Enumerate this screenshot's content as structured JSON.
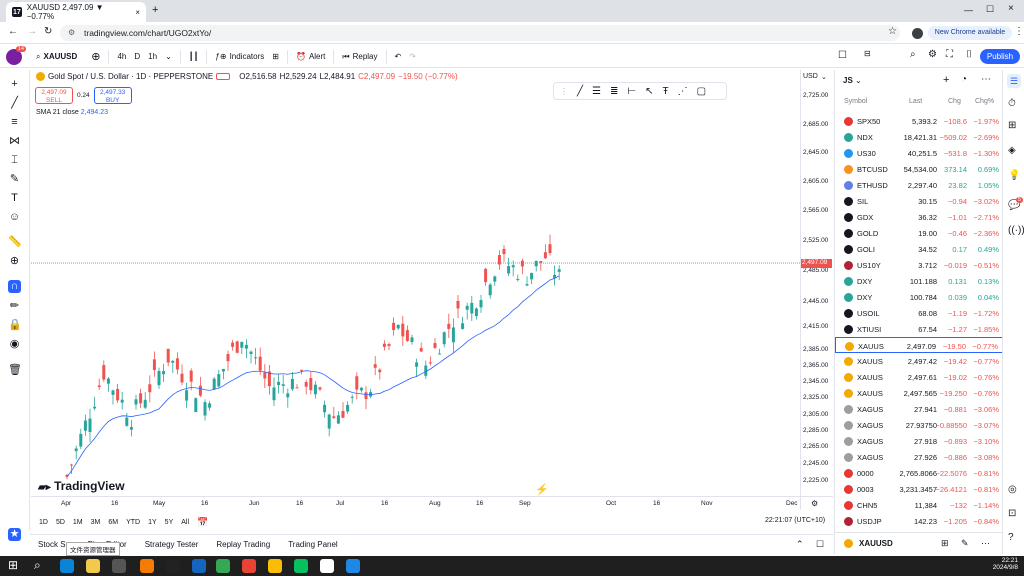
{
  "browser": {
    "tab_title": "XAUUSD 2,497.09 ▼ −0.77%",
    "url": "tradingview.com/chart/UGO2xtYo/",
    "update_btn": "New Chrome available"
  },
  "toolbar": {
    "symbol": "XAUUSD",
    "intervals": [
      "4h",
      "D",
      "1h"
    ],
    "indicators": "Indicators",
    "alert": "Alert",
    "replay": "Replay",
    "publish": "Publish",
    "badge": "14"
  },
  "legend": {
    "title": "Gold Spot / U.S. Dollar · 1D · PEPPERSTONE",
    "o": "O2,516.58",
    "h": "H2,529.24",
    "l": "L2,484.91",
    "c": "C2,497.09",
    "chg": "−19.50 (−0.77%)",
    "sell": "2,497.09",
    "sell_label": "SELL",
    "spread": "0.24",
    "buy": "2,497.33",
    "buy_label": "BUY",
    "sma": "SMA 21 close",
    "sma_val": "2,494.23"
  },
  "chart_data": {
    "type": "candlestick",
    "title": "Gold Spot / U.S. Dollar · 1D · PEPPERSTONE",
    "last_price": 2497.09,
    "currency": "USD",
    "ylim": [
      2212,
      2735
    ],
    "price_ticks": [
      "2,725.00",
      "2,685.00",
      "2,645.00",
      "2,605.00",
      "2,565.00",
      "2,525.00",
      "2,485.00",
      "2,445.00",
      "2,415.00",
      "2,385.00",
      "2,365.00",
      "2,345.00",
      "2,325.00",
      "2,305.00",
      "2,285.00",
      "2,265.00",
      "2,245.00",
      "2,225.00"
    ],
    "time_ticks": [
      "Apr",
      "16",
      "May",
      "16",
      "Jun",
      "16",
      "Jul",
      "16",
      "Aug",
      "16",
      "Sep",
      "Oct",
      "16",
      "Nov",
      "Dec"
    ],
    "sma_label": "SMA 21"
  },
  "watermark": "TradingView",
  "range_buttons": [
    "1D",
    "5D",
    "1M",
    "3M",
    "6M",
    "YTD",
    "1Y",
    "5Y",
    "All"
  ],
  "clock": "22:21:07 (UTC+10)",
  "panels": [
    "Stock Sc",
    "Pine Editor",
    "Strategy Tester",
    "Replay Trading",
    "Trading Panel"
  ],
  "tooltip": "文件资源管理器",
  "watchlist": {
    "name": "JS",
    "headers": [
      "Symbol",
      "Last",
      "Chg",
      "Chg%"
    ],
    "rows": [
      {
        "s": "SPX50",
        "l": "5,393.2",
        "c": "−108.6",
        "p": "−1.97%",
        "dir": "down",
        "ic": "#e53935"
      },
      {
        "s": "NDX",
        "l": "18,421.31",
        "c": "−509.02",
        "p": "−2.69%",
        "dir": "down",
        "ic": "#26a69a"
      },
      {
        "s": "US30",
        "l": "40,251.5",
        "c": "−531.8",
        "p": "−1.30%",
        "dir": "down",
        "ic": "#2196f3"
      },
      {
        "s": "BTCUSD",
        "l": "54,534.00",
        "c": "373.14",
        "p": "0.69%",
        "dir": "up",
        "ic": "#f7931a"
      },
      {
        "s": "ETHUSD",
        "l": "2,297.40",
        "c": "23.82",
        "p": "1.05%",
        "dir": "up",
        "ic": "#627eea"
      },
      {
        "s": "SIL",
        "l": "30.15",
        "c": "−0.94",
        "p": "−3.02%",
        "dir": "down",
        "ic": "#131722"
      },
      {
        "s": "GDX",
        "l": "36.32",
        "c": "−1.01",
        "p": "−2.71%",
        "dir": "down",
        "ic": "#131722"
      },
      {
        "s": "GOLD",
        "l": "19.00",
        "c": "−0.46",
        "p": "−2.36%",
        "dir": "down",
        "ic": "#131722"
      },
      {
        "s": "GOLI",
        "l": "34.52",
        "c": "0.17",
        "p": "0.49%",
        "dir": "up",
        "ic": "#131722"
      },
      {
        "s": "US10Y",
        "l": "3.712",
        "c": "−0.019",
        "p": "−0.51%",
        "dir": "down",
        "ic": "#b22234"
      },
      {
        "s": "DXY",
        "l": "101.188",
        "c": "0.131",
        "p": "0.13%",
        "dir": "up",
        "ic": "#26a69a"
      },
      {
        "s": "DXY",
        "l": "100.784",
        "c": "0.039",
        "p": "0.04%",
        "dir": "up",
        "ic": "#26a69a"
      },
      {
        "s": "USOIL",
        "l": "68.08",
        "c": "−1.19",
        "p": "−1.72%",
        "dir": "down",
        "ic": "#131722"
      },
      {
        "s": "XTIUSI",
        "l": "67.54",
        "c": "−1.27",
        "p": "−1.85%",
        "dir": "down",
        "ic": "#131722"
      },
      {
        "s": "XAUUS",
        "l": "2,497.09",
        "c": "−19.50",
        "p": "−0.77%",
        "dir": "down",
        "ic": "#f2a900"
      },
      {
        "s": "XAUUS",
        "l": "2,497.42",
        "c": "−19.42",
        "p": "−0.77%",
        "dir": "down",
        "ic": "#f2a900"
      },
      {
        "s": "XAUUS",
        "l": "2,497.61",
        "c": "−19.02",
        "p": "−0.76%",
        "dir": "down",
        "ic": "#f2a900"
      },
      {
        "s": "XAUUS",
        "l": "2,497.565",
        "c": "−19.250",
        "p": "−0.76%",
        "dir": "down",
        "ic": "#f2a900"
      },
      {
        "s": "XAGUS",
        "l": "27.941",
        "c": "−0.881",
        "p": "−3.06%",
        "dir": "down",
        "ic": "#9e9e9e"
      },
      {
        "s": "XAGUS",
        "l": "27.93750",
        "c": "−0.88550",
        "p": "−3.07%",
        "dir": "down",
        "ic": "#9e9e9e"
      },
      {
        "s": "XAGUS",
        "l": "27.918",
        "c": "−0.893",
        "p": "−3.10%",
        "dir": "down",
        "ic": "#9e9e9e"
      },
      {
        "s": "XAGUS",
        "l": "27.926",
        "c": "−0.886",
        "p": "−3.08%",
        "dir": "down",
        "ic": "#9e9e9e"
      },
      {
        "s": "0000",
        "l": "2,765.8066",
        "c": "−22.5076",
        "p": "−0.81%",
        "dir": "down",
        "ic": "#e53935"
      },
      {
        "s": "0003",
        "l": "3,231.3457",
        "c": "−26.4121",
        "p": "−0.81%",
        "dir": "down",
        "ic": "#e53935"
      },
      {
        "s": "CHN5",
        "l": "11,384",
        "c": "−132",
        "p": "−1.14%",
        "dir": "down",
        "ic": "#e53935"
      },
      {
        "s": "USDJP",
        "l": "142.23",
        "c": "−1.205",
        "p": "−0.84%",
        "dir": "down",
        "ic": "#b22234"
      }
    ],
    "footer_symbol": "XAUUSD"
  },
  "colors": {
    "up": "#26a69a",
    "down": "#ef5350",
    "accent": "#2962ff",
    "sma": "#2962ff"
  },
  "taskbar": {
    "time": "22:21",
    "date": "2024/9/8"
  },
  "notif_count": "5"
}
